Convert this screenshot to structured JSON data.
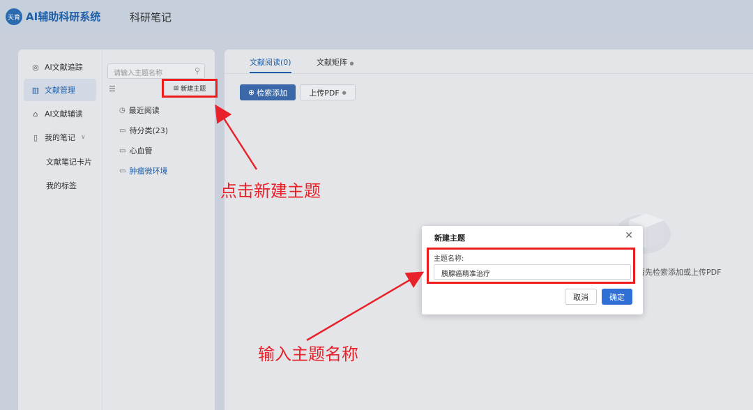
{
  "header": {
    "logo_text": "天育",
    "brand": "AI辅助科研系统",
    "page_name": "科研笔记"
  },
  "sidebar": {
    "items": [
      {
        "label": "AI文献追踪",
        "icon": "target-icon"
      },
      {
        "label": "文献管理",
        "icon": "books-icon",
        "active": true
      },
      {
        "label": "AI文献辅读",
        "icon": "bank-icon"
      },
      {
        "label": "我的笔记",
        "icon": "notebook-icon",
        "expand": "∨"
      }
    ],
    "sub_items": [
      "文献笔记卡片",
      "我的标签"
    ]
  },
  "topics": {
    "search_placeholder": "请输入主题名称",
    "new_topic_label": "新建主题",
    "list": [
      {
        "label": "最近阅读",
        "icon": "clock-icon"
      },
      {
        "label": "待分类(23)",
        "icon": "folder-icon"
      },
      {
        "label": "心血管",
        "icon": "folder-icon"
      },
      {
        "label": "肿瘤微环境",
        "icon": "folder-icon",
        "selected": true
      }
    ]
  },
  "main": {
    "tabs": [
      "文献阅读(0)",
      "文献矩阵"
    ],
    "search_add_label": "检索添加",
    "upload_label": "上传PDF",
    "empty_text": "请先检索添加或上传PDF"
  },
  "modal": {
    "title": "新建主题",
    "field_label": "主题名称:",
    "field_value": "胰腺癌精准治疗",
    "cancel_label": "取消",
    "ok_label": "确定"
  },
  "annotations": {
    "click_new_topic": "点击新建主题",
    "enter_topic_name": "输入主题名称"
  },
  "colors": {
    "accent": "#1f5fa8",
    "primary_button": "#2f6fd6",
    "annotation_red": "#e8222b"
  }
}
